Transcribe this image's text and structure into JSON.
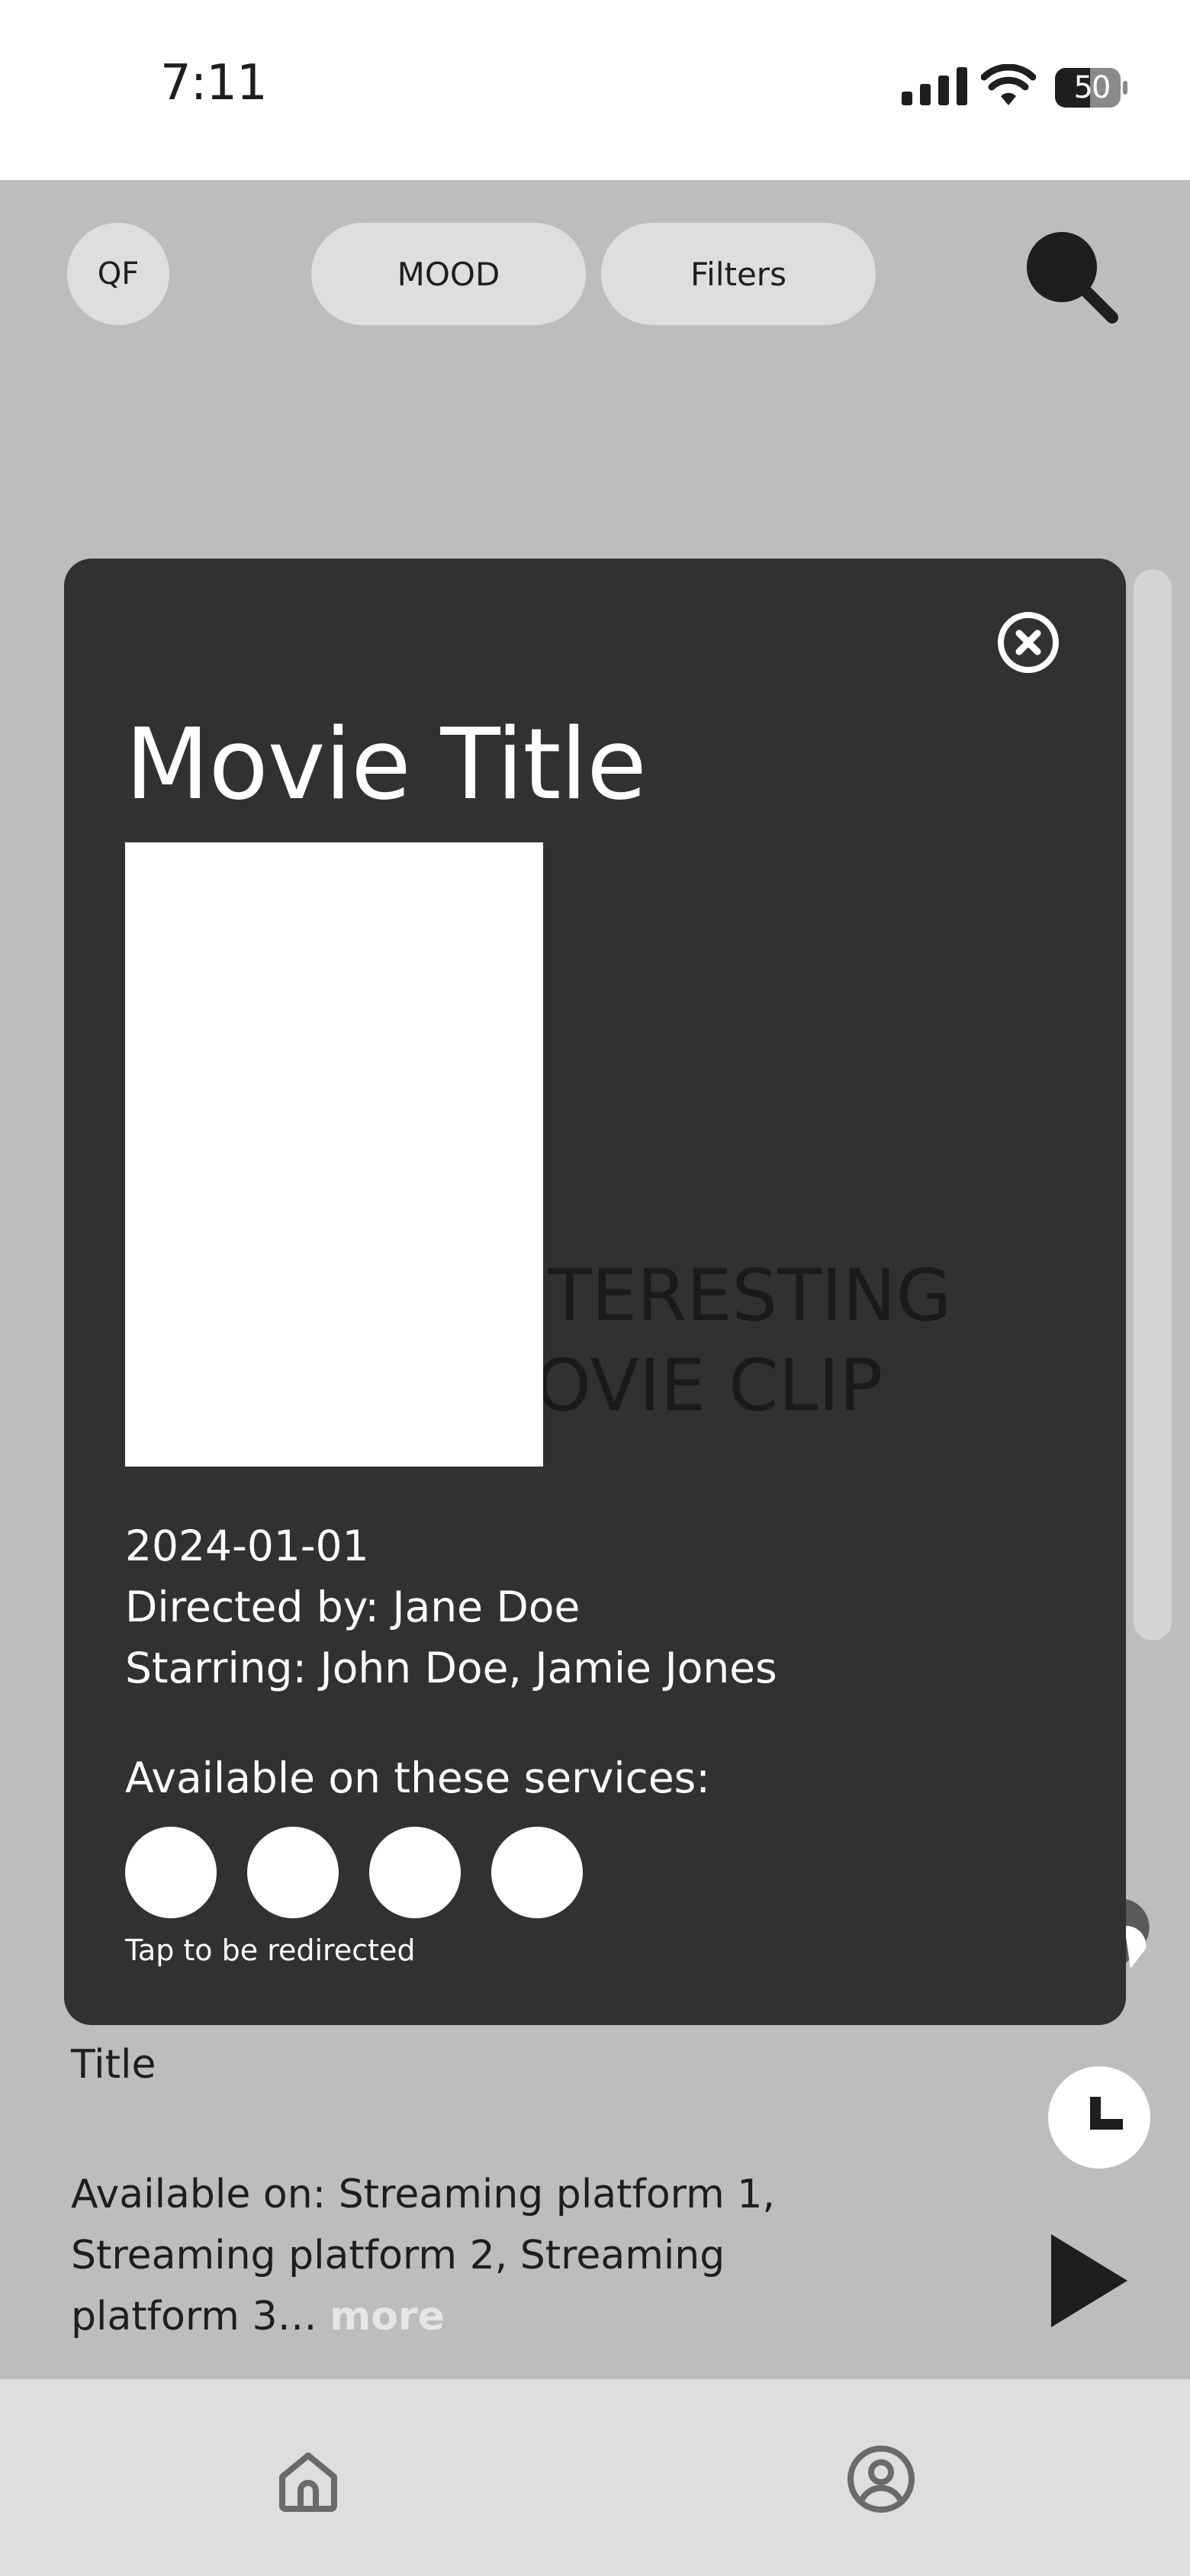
{
  "status_bar": {
    "time": "7:11",
    "battery": "50"
  },
  "top_bar": {
    "qf_label": "QF",
    "mood_label": "MOOD",
    "filters_label": "Filters"
  },
  "modal": {
    "title": "Movie Title",
    "clip_text_line1": "INTERESTING",
    "clip_text_line2": "MOVIE CLIP",
    "date": "2024-01-01",
    "directed_by": "Directed by: Jane Doe",
    "starring": "Starring: John Doe, Jamie Jones",
    "services_heading": "Available on these services:",
    "hint": "Tap to be redirected"
  },
  "feed": {
    "title": "Title",
    "available_on": "Available on: Streaming platform 1, Streaming platform 2, Streaming platform 3…",
    "more_label": "more"
  },
  "icons": {
    "search": "search-icon",
    "close": "close-icon",
    "heart": "heart-icon",
    "clock": "clock-icon",
    "play": "play-icon",
    "home": "home-icon",
    "profile": "profile-icon"
  },
  "colors": {
    "modal_bg": "#313131",
    "app_bg": "#bdbdbd",
    "pill_bg": "#dedede"
  }
}
